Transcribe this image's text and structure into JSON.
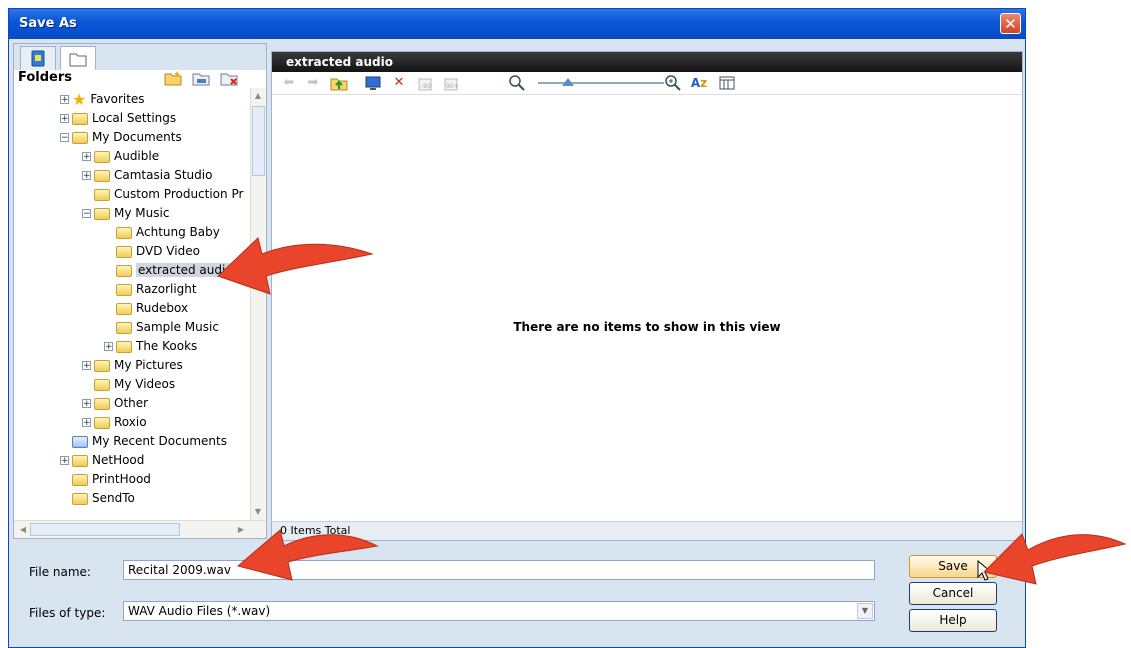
{
  "window": {
    "title": "Save As",
    "close_glyph": "✕"
  },
  "left_panel": {
    "tabs": [
      {
        "icon": "desktop-tab-icon"
      },
      {
        "icon": "folder-tab-icon"
      }
    ],
    "header": "Folders",
    "header_icons": [
      "new-folder-icon",
      "rename-folder-icon",
      "delete-folder-icon"
    ],
    "tree": [
      {
        "label": "Favorites",
        "icon": "star-icon",
        "expander": "+"
      },
      {
        "label": "Local Settings",
        "icon": "folder-icon",
        "expander": "+"
      },
      {
        "label": "My Documents",
        "icon": "folder-icon",
        "expander": "−"
      },
      {
        "label": "Audible",
        "icon": "folder-icon",
        "expander": "+"
      },
      {
        "label": "Camtasia Studio",
        "icon": "folder-icon",
        "expander": "+"
      },
      {
        "label": "Custom Production Pr",
        "icon": "folder-icon",
        "expander": ""
      },
      {
        "label": "My Music",
        "icon": "folder-icon",
        "expander": "−"
      },
      {
        "label": "Achtung Baby",
        "icon": "folder-icon",
        "expander": ""
      },
      {
        "label": "DVD Video",
        "icon": "folder-icon",
        "expander": ""
      },
      {
        "label": "extracted audio",
        "icon": "folder-icon",
        "expander": "",
        "selected": true
      },
      {
        "label": "Razorlight",
        "icon": "folder-icon",
        "expander": ""
      },
      {
        "label": "Rudebox",
        "icon": "folder-icon",
        "expander": ""
      },
      {
        "label": "Sample Music",
        "icon": "folder-icon",
        "expander": ""
      },
      {
        "label": "The Kooks",
        "icon": "folder-icon",
        "expander": "+"
      },
      {
        "label": "My Pictures",
        "icon": "folder-icon",
        "expander": "+"
      },
      {
        "label": "My Videos",
        "icon": "folder-icon",
        "expander": ""
      },
      {
        "label": "Other",
        "icon": "folder-icon",
        "expander": "+"
      },
      {
        "label": "Roxio",
        "icon": "folder-icon",
        "expander": "+"
      },
      {
        "label": "My Recent Documents",
        "icon": "recent-docs-icon",
        "expander": ""
      },
      {
        "label": "NetHood",
        "icon": "folder-icon",
        "expander": "+"
      },
      {
        "label": "PrintHood",
        "icon": "folder-icon",
        "expander": ""
      },
      {
        "label": "SendTo",
        "icon": "folder-icon",
        "expander": ""
      }
    ]
  },
  "right_panel": {
    "path_title": "extracted audio",
    "toolbar_icons": [
      "back-icon",
      "forward-icon",
      "up-folder-icon",
      "desktop-icon",
      "delete-icon",
      "rotate-left-icon",
      "rotate-right-icon",
      "zoom-out-icon",
      "zoom-in-icon",
      "sort-icon",
      "view-icon"
    ],
    "empty_message": "There are no items to show in this view",
    "status": "0 Items Total"
  },
  "form": {
    "file_name_label": "File name:",
    "file_name_value": "Recital 2009.wav",
    "file_type_label": "Files of type:",
    "file_type_value": "WAV Audio Files (*.wav)",
    "save_label": "Save",
    "cancel_label": "Cancel",
    "help_label": "Help"
  },
  "colors": {
    "title_bar": "#0a58d6",
    "dialog_bg": "#d8e4f0",
    "annotation_arrow": "#e8452a"
  }
}
